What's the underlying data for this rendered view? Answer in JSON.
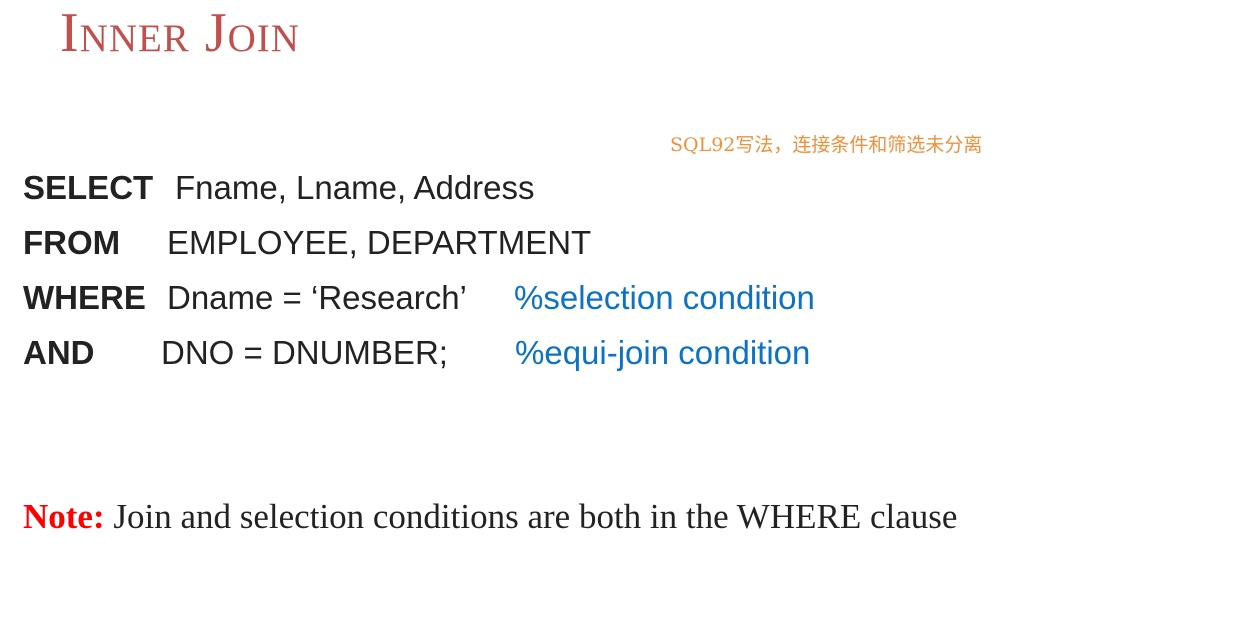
{
  "slide": {
    "title": "Inner Join"
  },
  "annotation": {
    "text": "SQL92写法，连接条件和筛选未分离"
  },
  "sql": {
    "lines": [
      {
        "keyword": "SELECT",
        "text": "Fname, Lname, Address",
        "comment": ""
      },
      {
        "keyword": "FROM",
        "text": "EMPLOYEE, DEPARTMENT",
        "comment": ""
      },
      {
        "keyword": "WHERE",
        "text": "Dname = ‘Research’",
        "comment": "%selection condition"
      },
      {
        "keyword": "AND",
        "text": "DNO = DNUMBER;",
        "comment": "%equi-join condition"
      }
    ]
  },
  "note": {
    "label": "Note:",
    "text": "Join and selection conditions are both in the WHERE clause"
  },
  "colors": {
    "title": "#c0504d",
    "annotation": "#f0903c",
    "comment": "#0b72c4",
    "note_label": "#ff0000",
    "text": "#222222"
  }
}
